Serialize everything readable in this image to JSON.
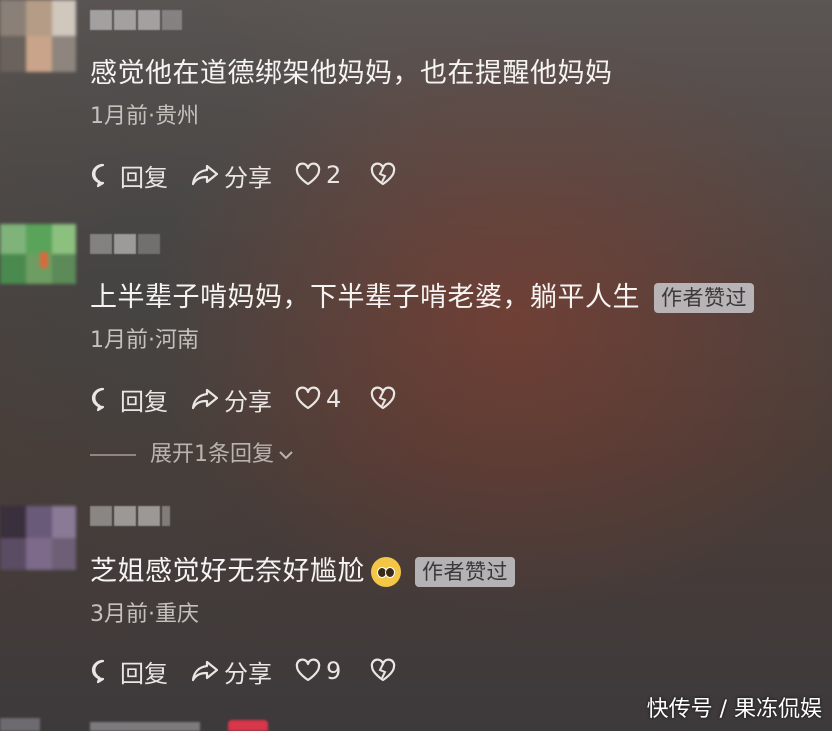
{
  "comments": [
    {
      "text": "感觉他在道德绑架他妈妈，也在提醒他妈妈",
      "meta": "1月前·贵州",
      "reply_label": "回复",
      "share_label": "分享",
      "likes": "2",
      "badge": ""
    },
    {
      "text": "上半辈子啃妈妈，下半辈子啃老婆，躺平人生",
      "meta": "1月前·河南",
      "reply_label": "回复",
      "share_label": "分享",
      "likes": "4",
      "badge": "作者赞过",
      "expand_label": "展开1条回复"
    },
    {
      "text": "芝姐感觉好无奈好尴尬",
      "meta": "3月前·重庆",
      "reply_label": "回复",
      "share_label": "分享",
      "likes": "9",
      "badge": "作者赞过",
      "emoji": "pleading-face"
    }
  ],
  "watermark": "快传号 / 果冻侃娱",
  "icons": [
    "reply-bubble-icon",
    "share-arrow-icon",
    "heart-icon",
    "broken-heart-icon",
    "chevron-down-icon"
  ]
}
